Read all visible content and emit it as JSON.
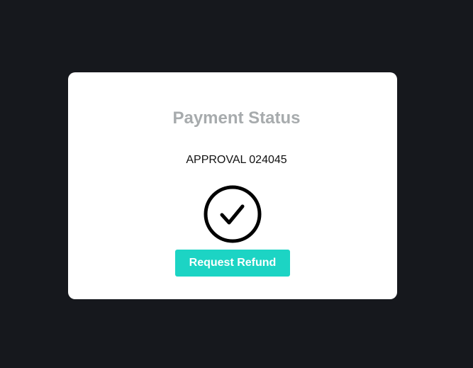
{
  "card": {
    "title": "Payment Status",
    "approval_text": "APPROVAL 024045",
    "status_icon": "check-circle-icon",
    "refund_button_label": "Request Refund"
  },
  "colors": {
    "background": "#16181d",
    "card": "#ffffff",
    "title": "#a7abad",
    "accent": "#1cd4c4"
  }
}
